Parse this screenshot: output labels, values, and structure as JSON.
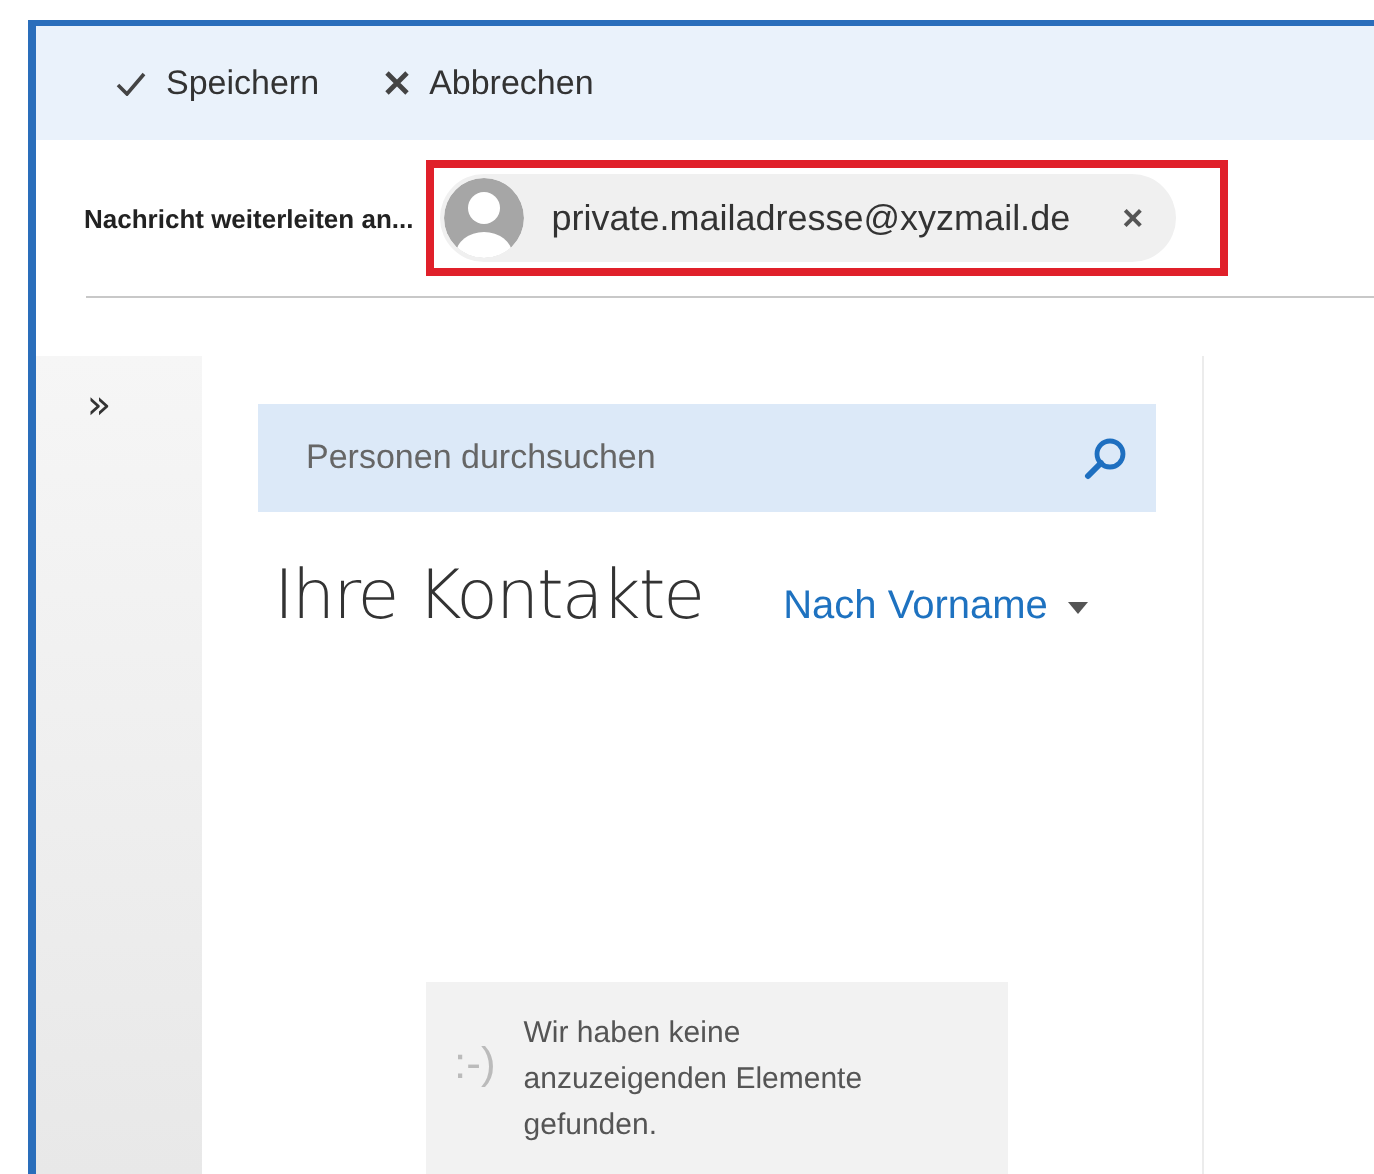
{
  "toolbar": {
    "buttons": [
      {
        "kind": "save",
        "label": "Speichern"
      },
      {
        "kind": "cancel",
        "label": "Abbrechen"
      }
    ]
  },
  "forward": {
    "label": "Nachricht weiterleiten an...",
    "recipient": {
      "address": "private.mailadresse@xyzmail.de",
      "highlighted": true,
      "remove": "×"
    }
  },
  "sidebar": {
    "toggle": "»"
  },
  "people": {
    "search": {
      "placeholder": "Personen durchsuchen"
    },
    "title": "Ihre Kontakte",
    "sort": "Nach Vorname",
    "empty": {
      "emoticon": ":-)",
      "message": "Wir haben keine anzuzeigenden Elemente gefunden."
    }
  }
}
